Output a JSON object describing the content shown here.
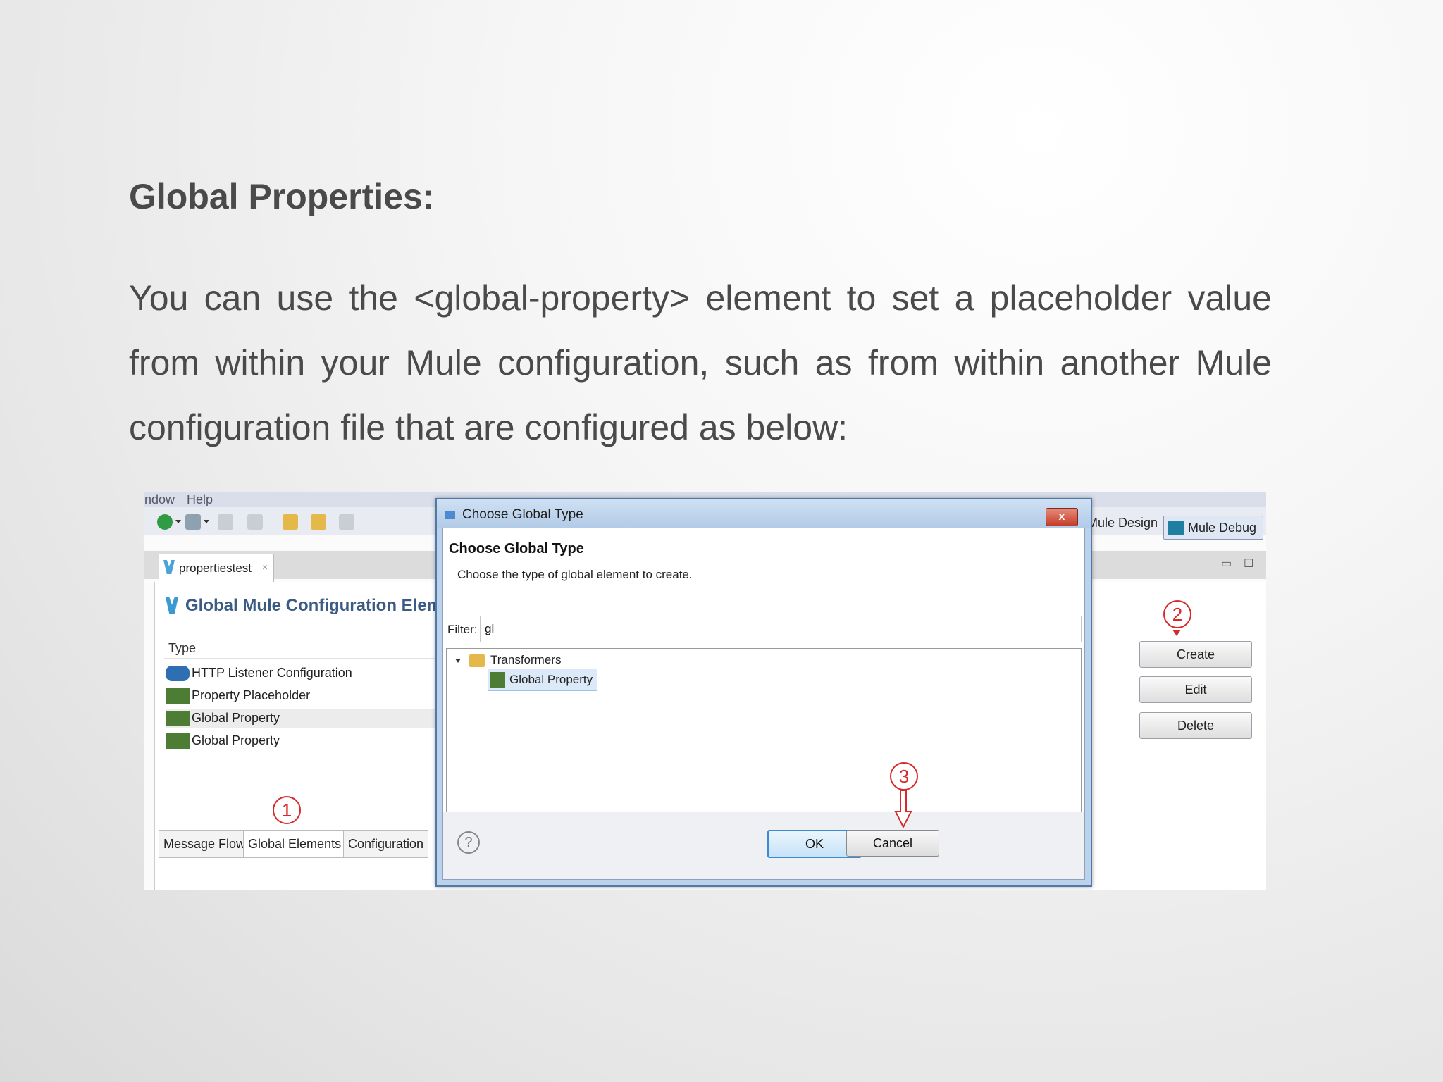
{
  "slide": {
    "title": "Global Properties:",
    "body": "You can use the <global-property> element to set a placeholder value from within your Mule configuration, such as from within another Mule configuration file that are configured as below:"
  },
  "ide": {
    "menu": [
      "ndow",
      "Help"
    ],
    "perspectives": {
      "design": "Mule Design",
      "debug": "Mule Debug"
    },
    "editor_tab": "propertiestest",
    "panel_title": "Global Mule Configuration Elem",
    "column_header": "Type",
    "elements": [
      {
        "label": "HTTP Listener Configuration",
        "icon": "http-icon"
      },
      {
        "label": "Property Placeholder",
        "icon": "property-icon"
      },
      {
        "label": "Global Property",
        "icon": "property-icon",
        "selected": true
      },
      {
        "label": "Global Property",
        "icon": "property-icon"
      }
    ],
    "bottom_tabs": [
      "Message Flow",
      "Global Elements",
      "Configuration"
    ],
    "buttons": {
      "create": "Create",
      "edit": "Edit",
      "delete": "Delete"
    }
  },
  "dialog": {
    "title": "Choose Global Type",
    "heading": "Choose Global Type",
    "description": "Choose the type of global element to create.",
    "filter_label": "Filter:",
    "filter_value": "gl",
    "tree": {
      "folder": "Transformers",
      "item": "Global Property"
    },
    "help_glyph": "?",
    "ok": "OK",
    "cancel": "Cancel",
    "close_glyph": "x"
  },
  "callouts": [
    "1",
    "2",
    "3"
  ],
  "colors": {
    "callout": "#d62a2a",
    "accent": "#3b5b84",
    "property_icon": "#4d7d34"
  }
}
